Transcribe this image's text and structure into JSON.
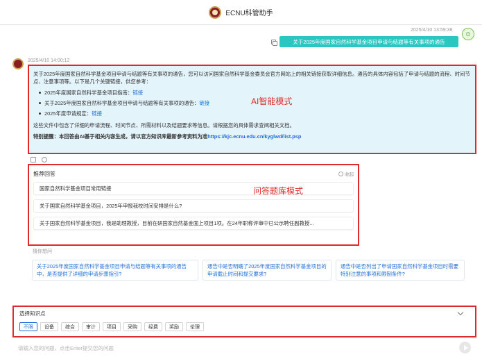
{
  "app": {
    "title": "ECNU科管助手"
  },
  "user_message": {
    "timestamp": "2025/4/10 13:59:38",
    "text": "关于2025年度国家自然科学基金项目申请与结题等有关事项的通告"
  },
  "bot_message": {
    "timestamp": "2025/4/10 14:00:12",
    "intro": "关于2025年度国家自然科学基金项目申请与结题等有关事项的通告，您可以访问国家自然科学基金委员会官方网站上的相关链接获取详细信息。通告的具体内容包括了申请与结题的流程、时间节点、注意事项等。以下是几个关键链接，供您参考：",
    "links": [
      {
        "label": "2025年度国家自然科学基金项目指南：",
        "link": "链接"
      },
      {
        "label": "关于2025年度国家自然科学基金项目申请与结题等有关事项的通告：",
        "link": "链接"
      },
      {
        "label": "2025年度申请规定：",
        "link": "链接"
      }
    ],
    "summary": "这些文件中包含了详细的申请流程、时间节点、所需材料以及结题要求等信息。请根据您的具体需求查阅相关文档。",
    "notice_label": "特别提醒：本回答由AI基于相关内容生成，请以官方知识库最新参考资料为准",
    "notice_url": "https://kjc.ecnu.edu.cn/kyglwd/list.psp"
  },
  "annotations": {
    "ai_mode": "AI智能模式",
    "qa_mode": "问答题库模式"
  },
  "recommend": {
    "title": "推荐回答",
    "collapse": "收起",
    "items": [
      "国家自然科学基金项目常用链接",
      "关于国家自然科学基金项目，2025年申报我校时间安排是什么?",
      "关于国家自然科学基金项目，我是助理教授，目前在研国家自然基金面上项目1项。在24年职称评审中已公示聘任副教授..."
    ]
  },
  "guess": {
    "title": "猜你想问",
    "items": [
      "关于2025年度国家自然科学基金项目申请与结题等有关事项的通告中，是否提供了详细的申请步骤指引?",
      "通告中是否明确了2025年度国家自然科学基金项目的申请截止时间和提交要求?",
      "通告中是否列出了申请国家自然科学基金项目时需要特别注意的事项和限制条件?"
    ]
  },
  "knowledge": {
    "title": "选择知识点",
    "chips": [
      "不限",
      "设备",
      "综合",
      "审计",
      "项目",
      "采购",
      "经费",
      "奖励",
      "伦理"
    ],
    "selected": "不限"
  },
  "input": {
    "placeholder": "请输入您的问题，点击Enter提交您的问题"
  },
  "colors": {
    "accent": "#2bc6c0",
    "highlight_border": "#e02a2a",
    "link": "#1e6fd9"
  }
}
